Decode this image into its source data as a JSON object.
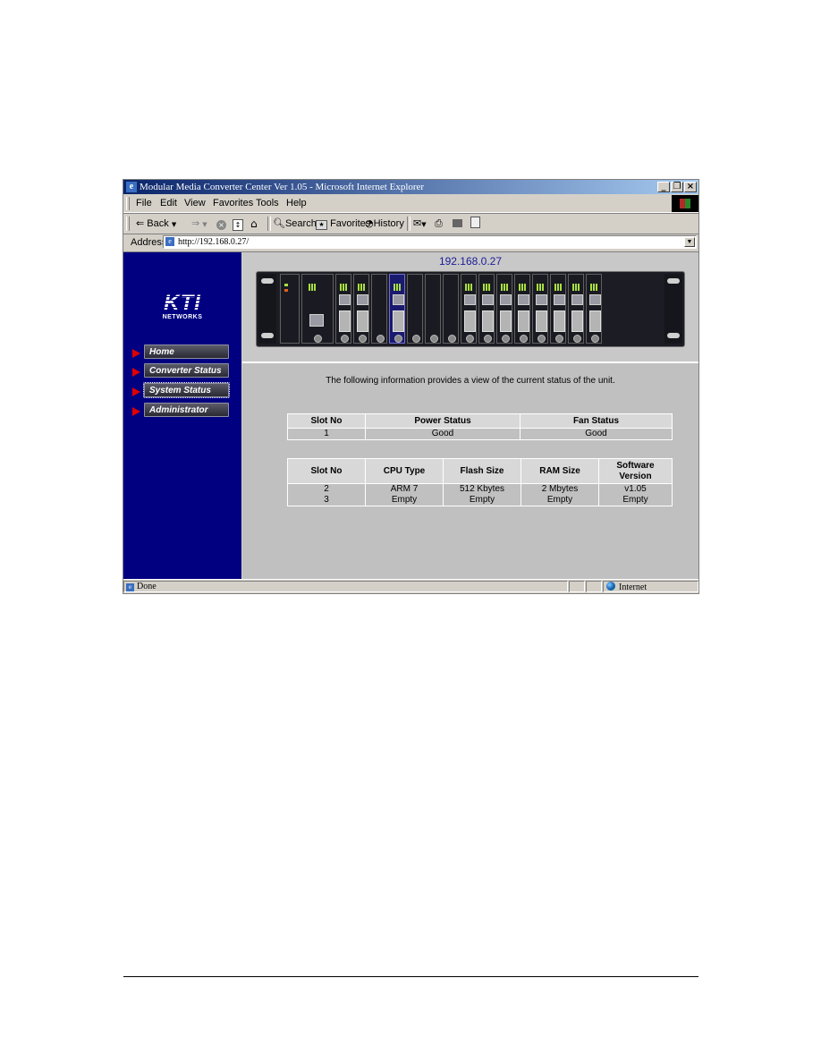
{
  "window": {
    "title": "Modular Media Converter Center Ver 1.05 - Microsoft Internet Explorer",
    "controls": [
      "minimize",
      "restore",
      "close"
    ]
  },
  "menubar": {
    "items": [
      {
        "label": "File",
        "accel": "F"
      },
      {
        "label": "Edit",
        "accel": "E"
      },
      {
        "label": "View",
        "accel": "V"
      },
      {
        "label": "Favorites",
        "accel": "a"
      },
      {
        "label": "Tools",
        "accel": "T"
      },
      {
        "label": "Help",
        "accel": "H"
      }
    ]
  },
  "toolbar": {
    "back_label": "Back",
    "search_label": "Search",
    "favorites_label": "Favorites",
    "history_label": "History",
    "icons": [
      "back-arrow-icon",
      "forward-arrow-icon",
      "stop-icon",
      "refresh-icon",
      "home-icon",
      "search-icon",
      "favorites-icon",
      "history-icon",
      "mail-icon",
      "print-icon",
      "edit-icon",
      "discuss-icon"
    ]
  },
  "address": {
    "label": "Address",
    "url": "http://192.168.0.27/"
  },
  "sidebar": {
    "logo_text": "KTI",
    "logo_subtext": "NETWORKS",
    "nav": [
      {
        "label": "Home"
      },
      {
        "label": "Converter Status"
      },
      {
        "label": "System Status",
        "focused": true
      },
      {
        "label": "Administrator"
      }
    ]
  },
  "chassis": {
    "ip": "192.168.0.27",
    "slots": [
      "psu",
      "mgmt",
      "module",
      "module",
      "empty",
      "module-selected",
      "empty",
      "empty",
      "empty",
      "module",
      "module",
      "module",
      "module",
      "module",
      "module",
      "module",
      "module"
    ]
  },
  "main": {
    "intro": "The following information provides a view of the current status of the unit.",
    "power_table": {
      "headers": [
        "Slot No",
        "Power Status",
        "Fan Status"
      ],
      "rows": [
        [
          "1",
          "Good",
          "Good"
        ]
      ]
    },
    "system_table": {
      "headers": [
        "Slot No",
        "CPU Type",
        "Flash Size",
        "RAM Size",
        "Software Version"
      ],
      "rows": [
        [
          "2",
          "ARM 7",
          "512 Kbytes",
          "2 Mbytes",
          "v1.05"
        ],
        [
          "3",
          "Empty",
          "Empty",
          "Empty",
          "Empty"
        ]
      ]
    }
  },
  "statusbar": {
    "status": "Done",
    "zone": "Internet"
  }
}
